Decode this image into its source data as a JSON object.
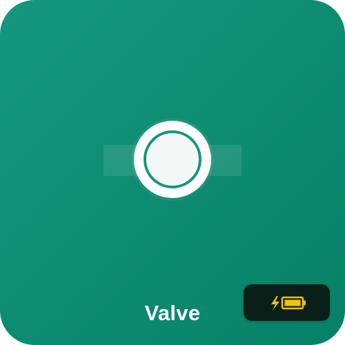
{
  "device": {
    "label": "Valve",
    "state": "open",
    "battery_status": "charging"
  },
  "icons": {
    "valve": "valve-icon",
    "charging": "lightning-icon",
    "battery": "battery-icon"
  },
  "colors": {
    "tile_start": "#15987f",
    "tile_end": "#078166",
    "valve_knob": "#f3f8f7",
    "badge_background": "#0b1f19",
    "battery_accent": "#f5c400",
    "label_text": "#ffffff"
  }
}
